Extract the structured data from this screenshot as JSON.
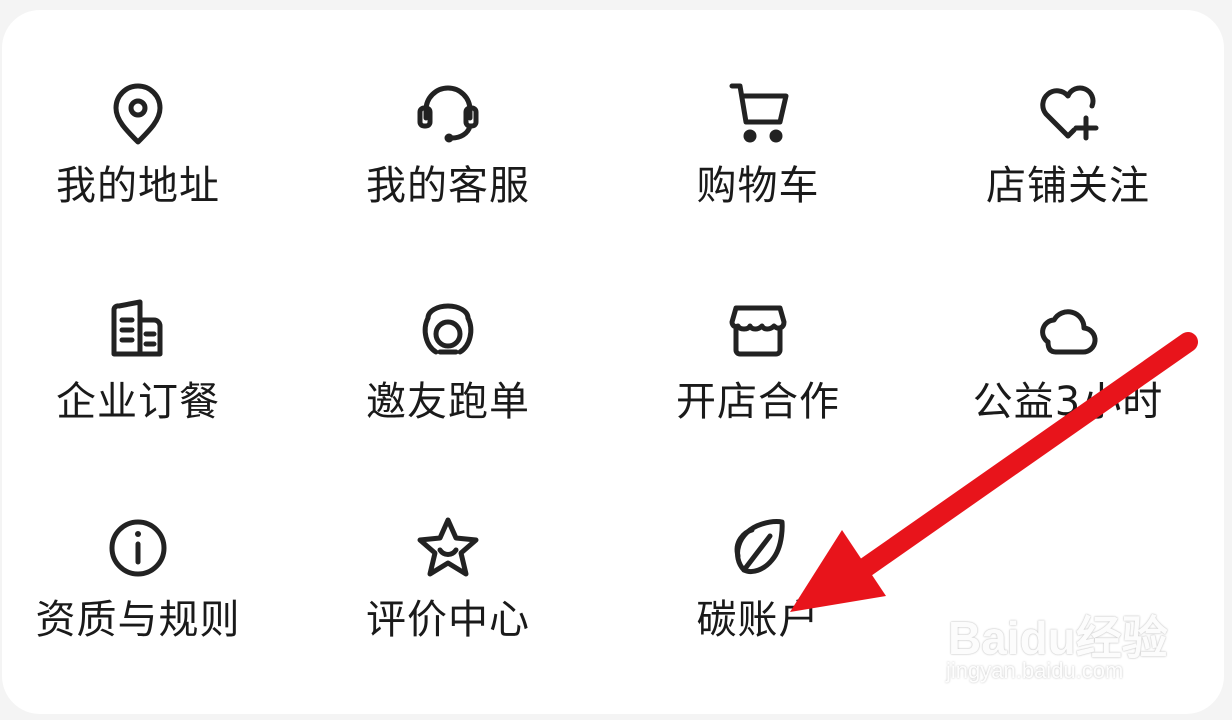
{
  "menu": {
    "items": [
      {
        "label": "我的地址",
        "icon": "location-pin-icon"
      },
      {
        "label": "我的客服",
        "icon": "headset-icon"
      },
      {
        "label": "购物车",
        "icon": "shopping-cart-icon"
      },
      {
        "label": "店铺关注",
        "icon": "heart-plus-icon"
      },
      {
        "label": "企业订餐",
        "icon": "building-icon"
      },
      {
        "label": "邀友跑单",
        "icon": "scooter-icon"
      },
      {
        "label": "开店合作",
        "icon": "storefront-icon"
      },
      {
        "label": "公益3小时",
        "icon": "cloud-icon"
      },
      {
        "label": "资质与规则",
        "icon": "info-circle-icon"
      },
      {
        "label": "评价中心",
        "icon": "star-smile-icon"
      },
      {
        "label": "碳账户",
        "icon": "leaf-icon"
      }
    ]
  },
  "annotation": {
    "arrow_color": "#e8141b"
  },
  "watermark": {
    "brand": "Baidu经验",
    "url": "jingyan.baidu.com"
  }
}
